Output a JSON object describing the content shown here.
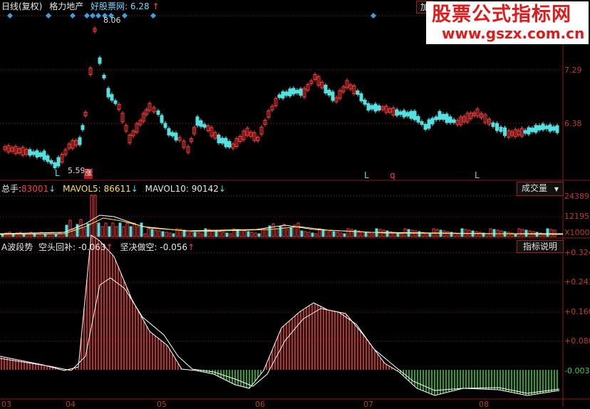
{
  "header": {
    "period": "日线(复权)",
    "stock_name": "格力地产",
    "source_label": "好股票网:",
    "source_value": "6.28",
    "arrow": "↑",
    "add_label": "加"
  },
  "price_axis": {
    "ticks": [
      "7.29",
      "6.38"
    ]
  },
  "price_annotations": {
    "high_label": "8.06",
    "low_label": "5.59",
    "zhang_label": "涨",
    "signal_marks": [
      "L",
      "q",
      "L"
    ]
  },
  "volume_panel": {
    "label1": "总手:",
    "value1": "83001",
    "label2": "MAVOL5:",
    "value2": "86611",
    "label3": "MAVOL10:",
    "value3": "90142",
    "arrow": "↓",
    "button": "成交量",
    "axis": [
      "24389",
      "12195",
      "X1000"
    ]
  },
  "indicator_panel": {
    "title": "A波段势",
    "label1": "空头回补:",
    "value1": "-0.063",
    "label2": "坚决做空:",
    "value2": "-0.056",
    "arrow": "↑",
    "button": "指标说明",
    "axis": [
      "+0.324",
      "+0.243",
      "+0.160",
      "+0.080",
      "-0.003"
    ]
  },
  "date_axis": [
    "03",
    "04",
    "05",
    "06",
    "07",
    "08"
  ],
  "watermark": {
    "line1": "股票公式指标网",
    "line2": "www.gszx.com.cn"
  },
  "colors": {
    "up": "#ff3b3b",
    "down": "#54e0e0",
    "grid": "#8b1a1a",
    "yellow": "#ffe14d",
    "green": "#3ecf3e",
    "cyan_text": "#6fd6ff"
  }
}
